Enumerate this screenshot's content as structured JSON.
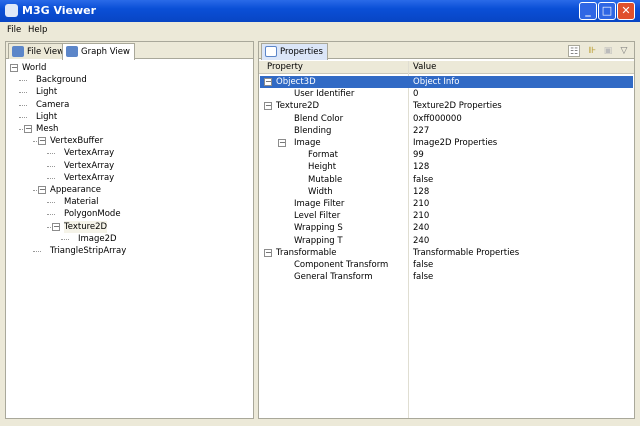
{
  "window": {
    "title": "M3G Viewer",
    "minimize": "_",
    "maximize": "□",
    "close": "✕"
  },
  "menu": [
    "File",
    "Help"
  ],
  "left": {
    "tabs": [
      "File View",
      "Graph View"
    ],
    "active_tab": "Graph View",
    "tree": [
      {
        "label": "World",
        "level": 0,
        "expander": "−"
      },
      {
        "label": "Background",
        "level": 1
      },
      {
        "label": "Light",
        "level": 1
      },
      {
        "label": "Camera",
        "level": 1
      },
      {
        "label": "Light",
        "level": 1
      },
      {
        "label": "Mesh",
        "level": 1,
        "expander": "−"
      },
      {
        "label": "VertexBuffer",
        "level": 2,
        "expander": "−"
      },
      {
        "label": "VertexArray",
        "level": 3
      },
      {
        "label": "VertexArray",
        "level": 3
      },
      {
        "label": "VertexArray",
        "level": 3
      },
      {
        "label": "Appearance",
        "level": 2,
        "expander": "−"
      },
      {
        "label": "Material",
        "level": 3
      },
      {
        "label": "PolygonMode",
        "level": 3
      },
      {
        "label": "Texture2D",
        "level": 3,
        "expander": "−",
        "highlight": true
      },
      {
        "label": "Image2D",
        "level": 4
      },
      {
        "label": "TriangleStripArray",
        "level": 2
      }
    ]
  },
  "right": {
    "tab": "Properties",
    "toolbar_icons": [
      "tree-layout-icon",
      "filter-icon",
      "restore-icon",
      "view-menu-icon"
    ],
    "columns": [
      "Property",
      "Value"
    ],
    "rows": [
      {
        "property": "Object3D",
        "value": "Object Info",
        "level": 0,
        "expander": "−",
        "selected": true
      },
      {
        "property": "User Identifier",
        "value": "0",
        "level": 1
      },
      {
        "property": "Texture2D",
        "value": "Texture2D Properties",
        "level": 0,
        "expander": "−"
      },
      {
        "property": "Blend Color",
        "value": "0xff000000",
        "level": 1
      },
      {
        "property": "Blending",
        "value": "227",
        "level": 1
      },
      {
        "property": "Image",
        "value": "Image2D Properties",
        "level": 1,
        "expander": "−"
      },
      {
        "property": "Format",
        "value": "99",
        "level": 2
      },
      {
        "property": "Height",
        "value": "128",
        "level": 2
      },
      {
        "property": "Mutable",
        "value": "false",
        "level": 2
      },
      {
        "property": "Width",
        "value": "128",
        "level": 2
      },
      {
        "property": "Image Filter",
        "value": "210",
        "level": 1
      },
      {
        "property": "Level Filter",
        "value": "210",
        "level": 1
      },
      {
        "property": "Wrapping S",
        "value": "240",
        "level": 1
      },
      {
        "property": "Wrapping T",
        "value": "240",
        "level": 1
      },
      {
        "property": "Transformable",
        "value": "Transformable Properties",
        "level": 0,
        "expander": "−"
      },
      {
        "property": "Component Transform",
        "value": "false",
        "level": 1
      },
      {
        "property": "General Transform",
        "value": "false",
        "level": 1
      }
    ]
  }
}
